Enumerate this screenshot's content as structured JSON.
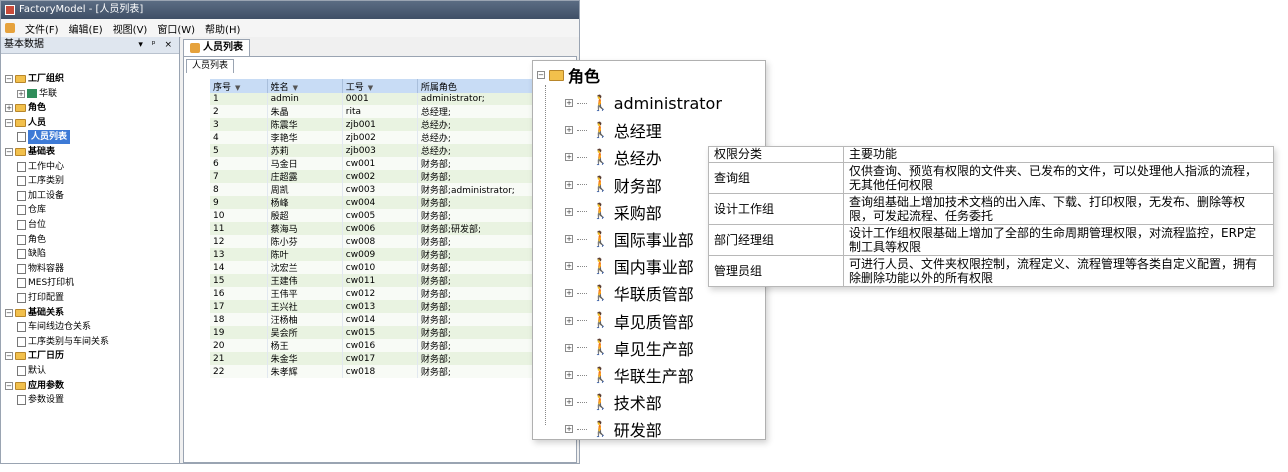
{
  "window": {
    "title": "FactoryModel - [人员列表]"
  },
  "menu": {
    "items": [
      "文件(F)",
      "编辑(E)",
      "视图(V)",
      "窗口(W)",
      "帮助(H)"
    ]
  },
  "sidebar": {
    "title": "基本数据",
    "controls": "▾ ᵖ ×",
    "tree": [
      {
        "label": "工厂组织",
        "level": 0,
        "icon": "folder",
        "expander": "-"
      },
      {
        "label": "华联",
        "level": 1,
        "icon": "house",
        "expander": "+"
      },
      {
        "label": "角色",
        "level": 0,
        "icon": "folder",
        "expander": "+"
      },
      {
        "label": "人员",
        "level": 0,
        "icon": "folder",
        "expander": "-"
      },
      {
        "label": "人员列表",
        "level": 1,
        "icon": "doc",
        "selected": true
      },
      {
        "label": "基础表",
        "level": 0,
        "icon": "folder",
        "expander": "-"
      },
      {
        "label": "工作中心",
        "level": 1,
        "icon": "doc"
      },
      {
        "label": "工序类别",
        "level": 1,
        "icon": "doc"
      },
      {
        "label": "加工设备",
        "level": 1,
        "icon": "doc"
      },
      {
        "label": "仓库",
        "level": 1,
        "icon": "doc"
      },
      {
        "label": "台位",
        "level": 1,
        "icon": "doc"
      },
      {
        "label": "角色",
        "level": 1,
        "icon": "doc"
      },
      {
        "label": "缺陷",
        "level": 1,
        "icon": "doc"
      },
      {
        "label": "物料容器",
        "level": 1,
        "icon": "doc"
      },
      {
        "label": "MES打印机",
        "level": 1,
        "icon": "doc"
      },
      {
        "label": "打印配置",
        "level": 1,
        "icon": "doc"
      },
      {
        "label": "基础关系",
        "level": 0,
        "icon": "folder",
        "expander": "-"
      },
      {
        "label": "车间线边仓关系",
        "level": 1,
        "icon": "doc"
      },
      {
        "label": "工序类别与车间关系",
        "level": 1,
        "icon": "doc"
      },
      {
        "label": "工厂日历",
        "level": 0,
        "icon": "folder",
        "expander": "-"
      },
      {
        "label": "默认",
        "level": 1,
        "icon": "doc"
      },
      {
        "label": "应用参数",
        "level": 0,
        "icon": "folder",
        "expander": "-"
      },
      {
        "label": "参数设置",
        "level": 1,
        "icon": "doc"
      }
    ]
  },
  "main": {
    "doc_tab": "人员列表",
    "inner_tab": "人员列表",
    "columns": [
      "序号",
      "姓名",
      "工号",
      "所属角色"
    ],
    "rows": [
      [
        "1",
        "admin",
        "0001",
        "administrator;"
      ],
      [
        "2",
        "朱晶",
        "rita",
        "总经理;"
      ],
      [
        "3",
        "陈震华",
        "zjb001",
        "总经办;"
      ],
      [
        "4",
        "李艳华",
        "zjb002",
        "总经办;"
      ],
      [
        "5",
        "苏莉",
        "zjb003",
        "总经办;"
      ],
      [
        "6",
        "马金日",
        "cw001",
        "财务部;"
      ],
      [
        "7",
        "庄超露",
        "cw002",
        "财务部;"
      ],
      [
        "8",
        "周凯",
        "cw003",
        "财务部;administrator;"
      ],
      [
        "9",
        "杨峰",
        "cw004",
        "财务部;"
      ],
      [
        "10",
        "殷超",
        "cw005",
        "财务部;"
      ],
      [
        "11",
        "蔡海马",
        "cw006",
        "财务部;研发部;"
      ],
      [
        "12",
        "陈小芬",
        "cw008",
        "财务部;"
      ],
      [
        "13",
        "陈叶",
        "cw009",
        "财务部;"
      ],
      [
        "14",
        "沈宏兰",
        "cw010",
        "财务部;"
      ],
      [
        "15",
        "王建伟",
        "cw011",
        "财务部;"
      ],
      [
        "16",
        "王伟平",
        "cw012",
        "财务部;"
      ],
      [
        "17",
        "王兴社",
        "cw013",
        "财务部;"
      ],
      [
        "18",
        "汪杨柚",
        "cw014",
        "财务部;"
      ],
      [
        "19",
        "吴会所",
        "cw015",
        "财务部;"
      ],
      [
        "20",
        "杨王",
        "cw016",
        "财务部;"
      ],
      [
        "21",
        "朱金华",
        "cw017",
        "财务部;"
      ],
      [
        "22",
        "朱孝辉",
        "cw018",
        "财务部;"
      ]
    ]
  },
  "roles": {
    "root": "角色",
    "items": [
      "administrator",
      "总经理",
      "总经办",
      "财务部",
      "采购部",
      "国际事业部",
      "国内事业部",
      "华联质管部",
      "卓见质管部",
      "卓见生产部",
      "华联生产部",
      "技术部",
      "研发部"
    ]
  },
  "permissions": {
    "header": [
      "权限分类",
      "主要功能"
    ],
    "rows": [
      [
        "查询组",
        "仅供查询、预览有权限的文件夹、已发布的文件，可以处理他人指派的流程，无其他任何权限"
      ],
      [
        "设计工作组",
        "查询组基础上增加技术文档的出入库、下载、打印权限，无发布、删除等权限，可发起流程、任务委托"
      ],
      [
        "部门经理组",
        "设计工作组权限基础上增加了全部的生命周期管理权限，对流程监控，ERP定制工具等权限"
      ],
      [
        "管理员组",
        "可进行人员、文件夹权限控制，流程定义、流程管理等各类自定义配置，拥有除删除功能以外的所有权限"
      ]
    ]
  }
}
